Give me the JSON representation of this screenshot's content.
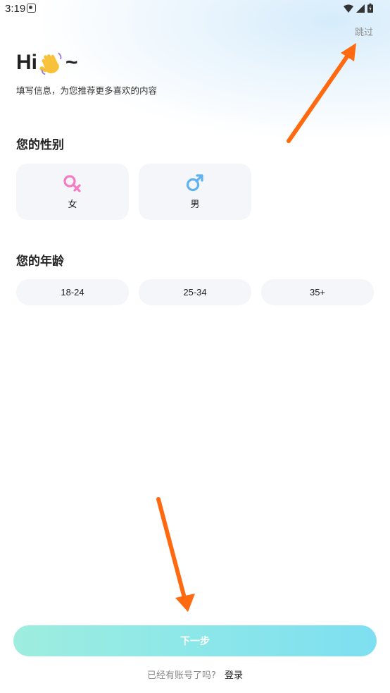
{
  "status_bar": {
    "time": "3:19"
  },
  "header": {
    "skip_label": "跳过",
    "greeting_prefix": "Hi",
    "greeting_suffix": "~",
    "subtitle": "填写信息，为您推荐更多喜欢的内容"
  },
  "gender_section": {
    "title": "您的性别",
    "options": [
      {
        "label": "女",
        "icon": "female-symbol-icon",
        "color": "#f47bc4"
      },
      {
        "label": "男",
        "icon": "male-symbol-icon",
        "color": "#5db3f0"
      }
    ]
  },
  "age_section": {
    "title": "您的年龄",
    "options": [
      "18-24",
      "25-34",
      "35+"
    ]
  },
  "footer": {
    "next_label": "下一步",
    "login_prompt": "已经有账号了吗?",
    "login_link": "登录"
  },
  "colors": {
    "arrow": "#ff6a10",
    "button_start": "#9eeddf",
    "button_end": "#7edff0",
    "card_bg": "#f5f6fa"
  }
}
